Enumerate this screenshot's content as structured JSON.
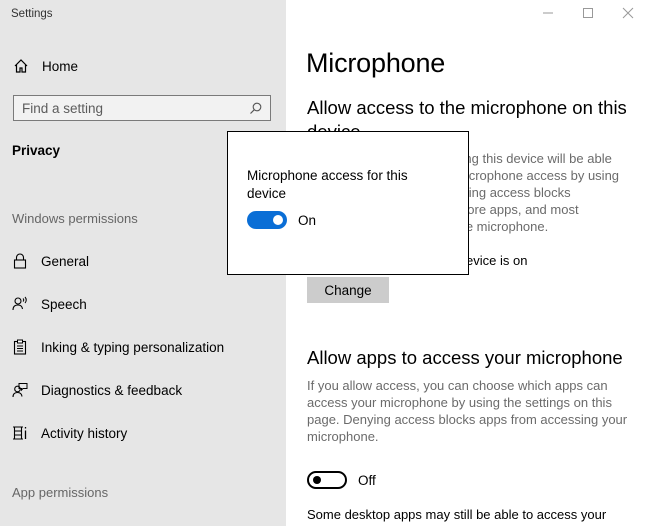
{
  "window": {
    "title": "Settings",
    "controls": {
      "minimize": "minimize",
      "maximize": "maximize",
      "close": "close"
    }
  },
  "sidebar": {
    "home_label": "Home",
    "search_placeholder": "Find a setting",
    "section_title": "Privacy",
    "windows_permissions_label": "Windows permissions",
    "items": [
      {
        "label": "General",
        "icon": "lock-icon"
      },
      {
        "label": "Speech",
        "icon": "speech-icon"
      },
      {
        "label": "Inking & typing personalization",
        "icon": "clipboard-icon"
      },
      {
        "label": "Diagnostics & feedback",
        "icon": "feedback-icon"
      },
      {
        "label": "Activity history",
        "icon": "activity-history-icon"
      }
    ],
    "app_permissions_label": "App permissions"
  },
  "main": {
    "page_title": "Microphone",
    "section1": {
      "heading_line1": "Allow access to the microphone on this",
      "heading_line2": "device",
      "desc_lines": [
        "sing this device will be able",
        "microphone access by using",
        "nying access blocks",
        " Store apps, and most",
        " the microphone."
      ],
      "status_fragment": "evice is on",
      "change_label": "Change"
    },
    "section2": {
      "heading": "Allow apps to access your microphone",
      "desc": "If you allow access, you can choose which apps can access your microphone by using the settings on this page. Denying access blocks apps from accessing your microphone.",
      "toggle_state": "Off",
      "toggle_on": false,
      "footer_text": "Some desktop apps may still be able to access your"
    }
  },
  "flyout": {
    "title": "Microphone access for this device",
    "toggle_state": "On",
    "toggle_on": true,
    "accent_color": "#0a6ed6"
  }
}
